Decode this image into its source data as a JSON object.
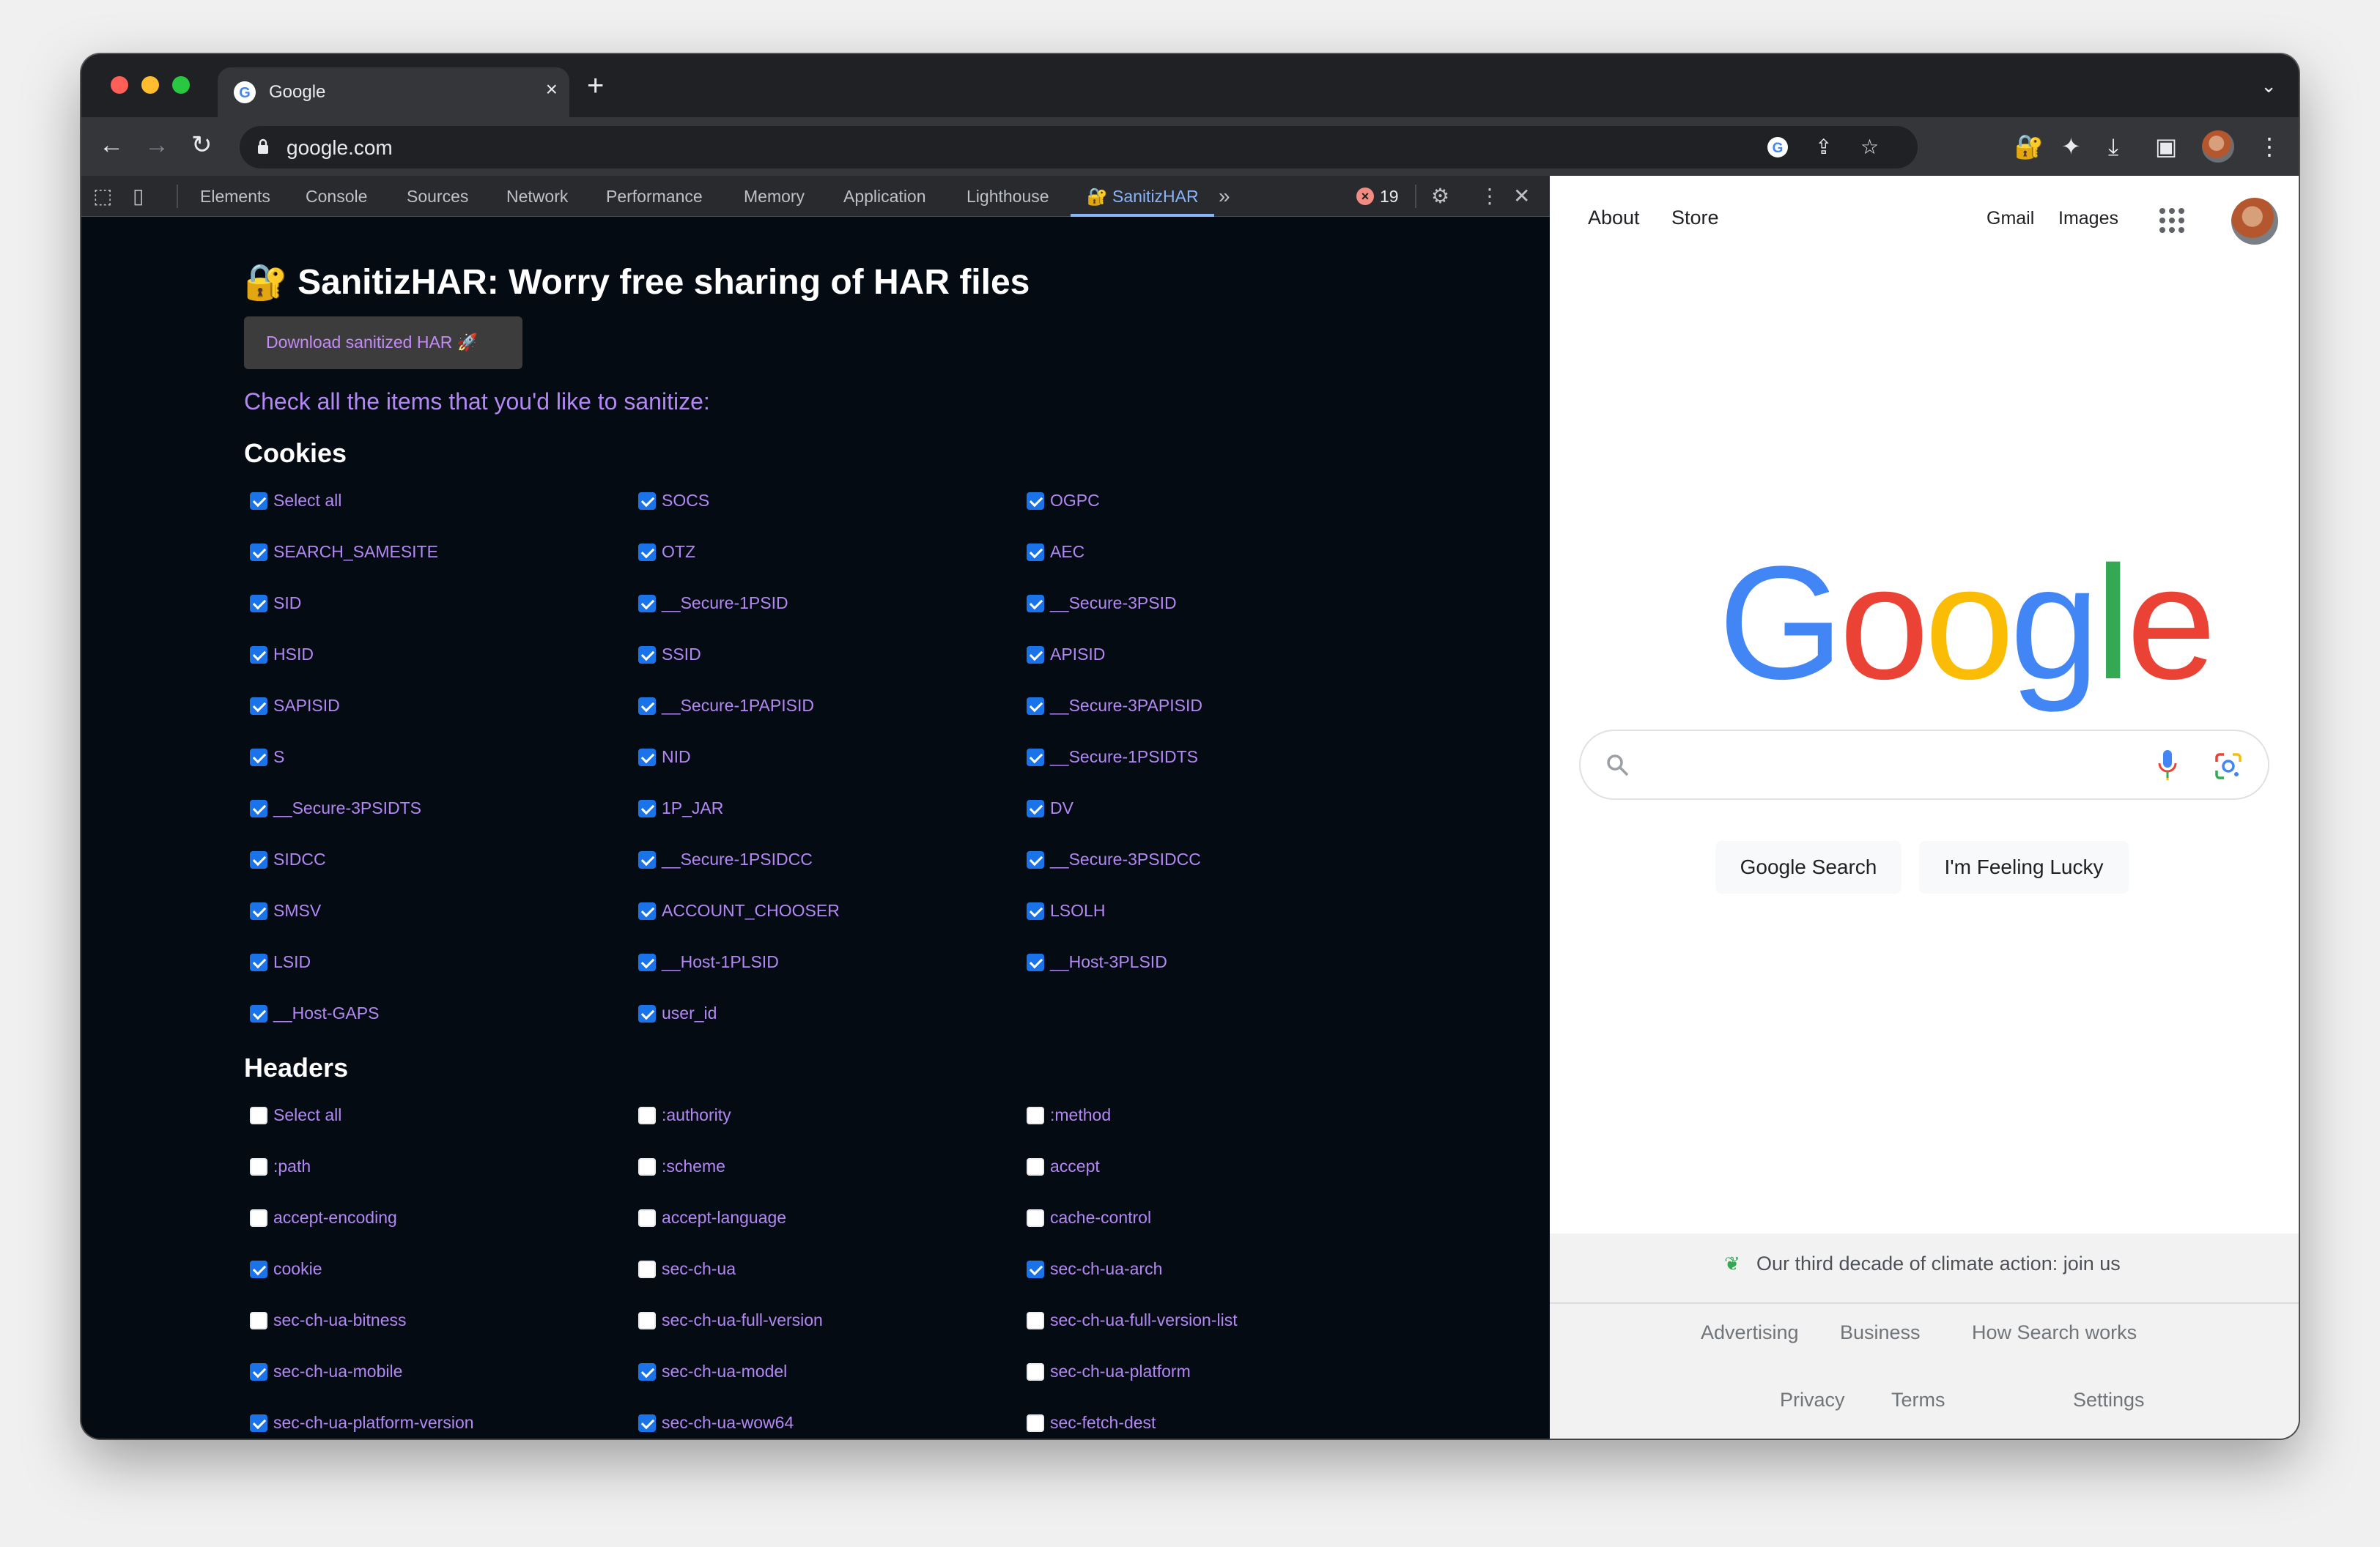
{
  "browser": {
    "tab_title": "Google",
    "url": "google.com"
  },
  "devtools": {
    "tabs": [
      "Elements",
      "Console",
      "Sources",
      "Network",
      "Performance",
      "Memory",
      "Application",
      "Lighthouse",
      "🔐 SanitizHAR"
    ],
    "active_tab": "🔐 SanitizHAR",
    "error_count": "19"
  },
  "sanitizhar": {
    "title": "🔐 SanitizHAR: Worry free sharing of HAR files",
    "download_button": "Download sanitized HAR 🚀",
    "prompt": "Check all the items that you'd like to sanitize:",
    "cookies_heading": "Cookies",
    "headers_heading": "Headers",
    "cookies": [
      {
        "label": "Select all",
        "checked": true
      },
      {
        "label": "SOCS",
        "checked": true
      },
      {
        "label": "OGPC",
        "checked": true
      },
      {
        "label": "SEARCH_SAMESITE",
        "checked": true
      },
      {
        "label": "OTZ",
        "checked": true
      },
      {
        "label": "AEC",
        "checked": true
      },
      {
        "label": "SID",
        "checked": true
      },
      {
        "label": "__Secure-1PSID",
        "checked": true
      },
      {
        "label": "__Secure-3PSID",
        "checked": true
      },
      {
        "label": "HSID",
        "checked": true
      },
      {
        "label": "SSID",
        "checked": true
      },
      {
        "label": "APISID",
        "checked": true
      },
      {
        "label": "SAPISID",
        "checked": true
      },
      {
        "label": "__Secure-1PAPISID",
        "checked": true
      },
      {
        "label": "__Secure-3PAPISID",
        "checked": true
      },
      {
        "label": "S",
        "checked": true
      },
      {
        "label": "NID",
        "checked": true
      },
      {
        "label": "__Secure-1PSIDTS",
        "checked": true
      },
      {
        "label": "__Secure-3PSIDTS",
        "checked": true
      },
      {
        "label": "1P_JAR",
        "checked": true
      },
      {
        "label": "DV",
        "checked": true
      },
      {
        "label": "SIDCC",
        "checked": true
      },
      {
        "label": "__Secure-1PSIDCC",
        "checked": true
      },
      {
        "label": "__Secure-3PSIDCC",
        "checked": true
      },
      {
        "label": "SMSV",
        "checked": true
      },
      {
        "label": "ACCOUNT_CHOOSER",
        "checked": true
      },
      {
        "label": "LSOLH",
        "checked": true
      },
      {
        "label": "LSID",
        "checked": true
      },
      {
        "label": "__Host-1PLSID",
        "checked": true
      },
      {
        "label": "__Host-3PLSID",
        "checked": true
      },
      {
        "label": "__Host-GAPS",
        "checked": true
      },
      {
        "label": "user_id",
        "checked": true
      }
    ],
    "headers": [
      {
        "label": "Select all",
        "checked": false
      },
      {
        "label": ":authority",
        "checked": false
      },
      {
        "label": ":method",
        "checked": false
      },
      {
        "label": ":path",
        "checked": false
      },
      {
        "label": ":scheme",
        "checked": false
      },
      {
        "label": "accept",
        "checked": false
      },
      {
        "label": "accept-encoding",
        "checked": false
      },
      {
        "label": "accept-language",
        "checked": false
      },
      {
        "label": "cache-control",
        "checked": false
      },
      {
        "label": "cookie",
        "checked": true
      },
      {
        "label": "sec-ch-ua",
        "checked": false
      },
      {
        "label": "sec-ch-ua-arch",
        "checked": true
      },
      {
        "label": "sec-ch-ua-bitness",
        "checked": false
      },
      {
        "label": "sec-ch-ua-full-version",
        "checked": false
      },
      {
        "label": "sec-ch-ua-full-version-list",
        "checked": false
      },
      {
        "label": "sec-ch-ua-mobile",
        "checked": true
      },
      {
        "label": "sec-ch-ua-model",
        "checked": true
      },
      {
        "label": "sec-ch-ua-platform",
        "checked": false
      },
      {
        "label": "sec-ch-ua-platform-version",
        "checked": true
      },
      {
        "label": "sec-ch-ua-wow64",
        "checked": true
      },
      {
        "label": "sec-fetch-dest",
        "checked": false
      }
    ]
  },
  "google": {
    "top_left": [
      "About",
      "Store"
    ],
    "top_right": [
      "Gmail",
      "Images"
    ],
    "logo_letters": [
      {
        "ch": "G",
        "color": "#4285f4"
      },
      {
        "ch": "o",
        "color": "#ea4335"
      },
      {
        "ch": "o",
        "color": "#fbbc05"
      },
      {
        "ch": "g",
        "color": "#4285f4"
      },
      {
        "ch": "l",
        "color": "#34a853"
      },
      {
        "ch": "e",
        "color": "#ea4335"
      }
    ],
    "search_button": "Google Search",
    "lucky_button": "I'm Feeling Lucky",
    "climate": "Our third decade of climate action: join us",
    "footer_row1": [
      "Advertising",
      "Business",
      "How Search works"
    ],
    "footer_row2": [
      "Privacy",
      "Terms",
      "Settings"
    ]
  }
}
